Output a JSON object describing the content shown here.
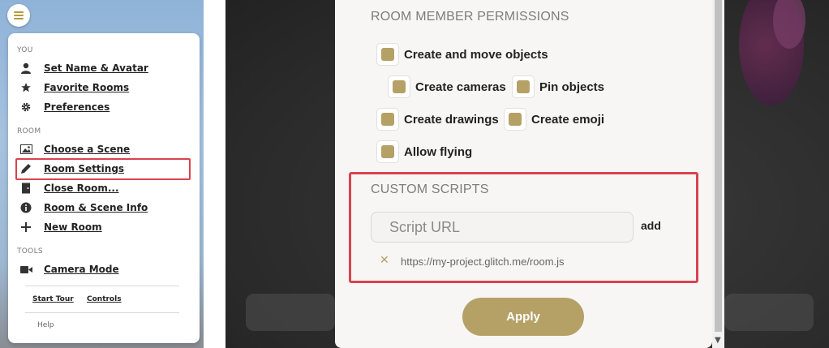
{
  "menu": {
    "you_heading": "YOU",
    "room_heading": "ROOM",
    "tools_heading": "TOOLS",
    "items": {
      "set_name_avatar": "Set Name & Avatar",
      "favorite_rooms": "Favorite Rooms",
      "preferences": "Preferences",
      "choose_scene": "Choose a Scene",
      "room_settings": "Room Settings",
      "close_room": "Close Room...",
      "room_scene_info": "Room & Scene Info",
      "new_room": "New Room",
      "camera_mode": "Camera Mode"
    },
    "start_tour": "Start Tour",
    "controls": "Controls",
    "help": "Help"
  },
  "dialog": {
    "permissions_title": "ROOM MEMBER PERMISSIONS",
    "permissions": {
      "create_move_objects": "Create and move objects",
      "create_cameras": "Create cameras",
      "pin_objects": "Pin objects",
      "create_drawings": "Create drawings",
      "create_emoji": "Create emoji",
      "allow_flying": "Allow flying"
    },
    "custom_scripts_title": "CUSTOM SCRIPTS",
    "script_placeholder": "Script URL",
    "add_label": "add",
    "script_entry": "https://my-project.glitch.me/room.js",
    "apply_label": "Apply"
  },
  "colors": {
    "accent": "#b5a166",
    "highlight": "#d9434f"
  }
}
